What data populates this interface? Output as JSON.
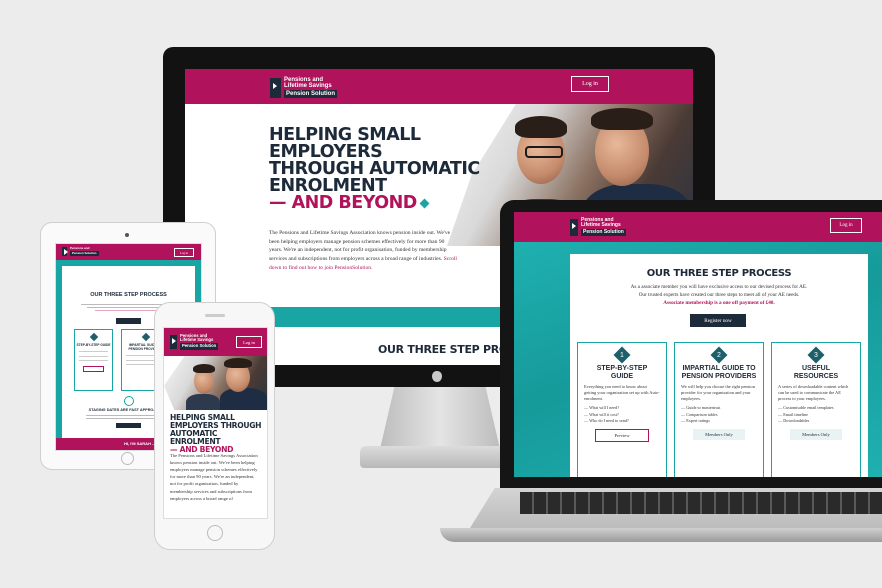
{
  "brand": {
    "name_line1": "Pensions and",
    "name_line2": "Lifetime Savings",
    "name_line3": "Pension Solution"
  },
  "nav": {
    "login_label": "Log in"
  },
  "hero": {
    "title_line1": "HELPING SMALL",
    "title_line2": "EMPLOYERS",
    "title_line3": "THROUGH AUTOMATIC",
    "title_line4": "ENROLMENT",
    "title_accent": "— AND BEYOND",
    "intro": "The Pensions and Lifetime Savings Association knows pension inside out. We've been helping employers manage pension schemes effectively for more than 90 years. We're an independent, not for profit organisation, funded by membership services and subscriptions from employers across a broad range of industries.",
    "intro_link": "Scroll down to find out how to join PensionSolution."
  },
  "section_title": "OUR THREE STEP PROCESS",
  "section_title_cut": "OUR THREE STEP PROCES",
  "process": {
    "line1": "As a associate member you will have exclusive access to our devised process for AE.",
    "line2": "Our trusted experts have created our three steps to meet all of your AE needs.",
    "line3": "Associate membership is a one off payment of £40.",
    "register_label": "Register now"
  },
  "steps": [
    {
      "number": "1",
      "title_line1": "STEP-BY-STEP",
      "title_line2": "GUIDE",
      "desc": "Everything you need to know about getting your organisation set up with Auto-enrolment.",
      "items": [
        "What will I need?",
        "What will it cost?",
        "Who do I need to send?"
      ],
      "button": "Preview"
    },
    {
      "number": "2",
      "title_line1": "IMPARTIAL GUIDE TO",
      "title_line2": "PENSION PROVIDERS",
      "desc": "We will help you choose the right pension provider for your organisation and your employees.",
      "items": [
        "Guide to mastertrust",
        "Comparison tables",
        "Expert ratings"
      ],
      "button": "Members Only"
    },
    {
      "number": "3",
      "title_line1": "USEFUL",
      "title_line2": "RESOURCES",
      "desc": "A series of downloadable content which can be used to communicate the AE process to your employees.",
      "items": [
        "Customisable email templates",
        "Email timeline",
        "Downloadables"
      ],
      "button": "Members Only"
    }
  ],
  "tablet": {
    "title": "OUR THREE STEP PROCESS",
    "card1": "STEP-BY-STEP GUIDE",
    "card2": "IMPARTIAL GUIDE TO PENSION PROVIDERS",
    "staging_title": "STAGING DATES ARE FAST APPROACHING",
    "footer_text": "HI, I'M SARAH – AT THE P"
  },
  "phone": {
    "title": "HELPING SMALL EMPLOYERS THROUGH AUTOMATIC ENROLMENT",
    "accent": "— AND BEYOND",
    "body": "The Pensions and Lifetime Savings Association knows pension inside out. We've been helping employers manage pension schemes effectively for more than 90 years. We're an independent, not for profit organisation, funded by membership services and subscriptions from employers across a broad range of"
  },
  "colors": {
    "magenta": "#b0135b",
    "teal": "#1aa5a5",
    "navy": "#1d2a3a"
  }
}
